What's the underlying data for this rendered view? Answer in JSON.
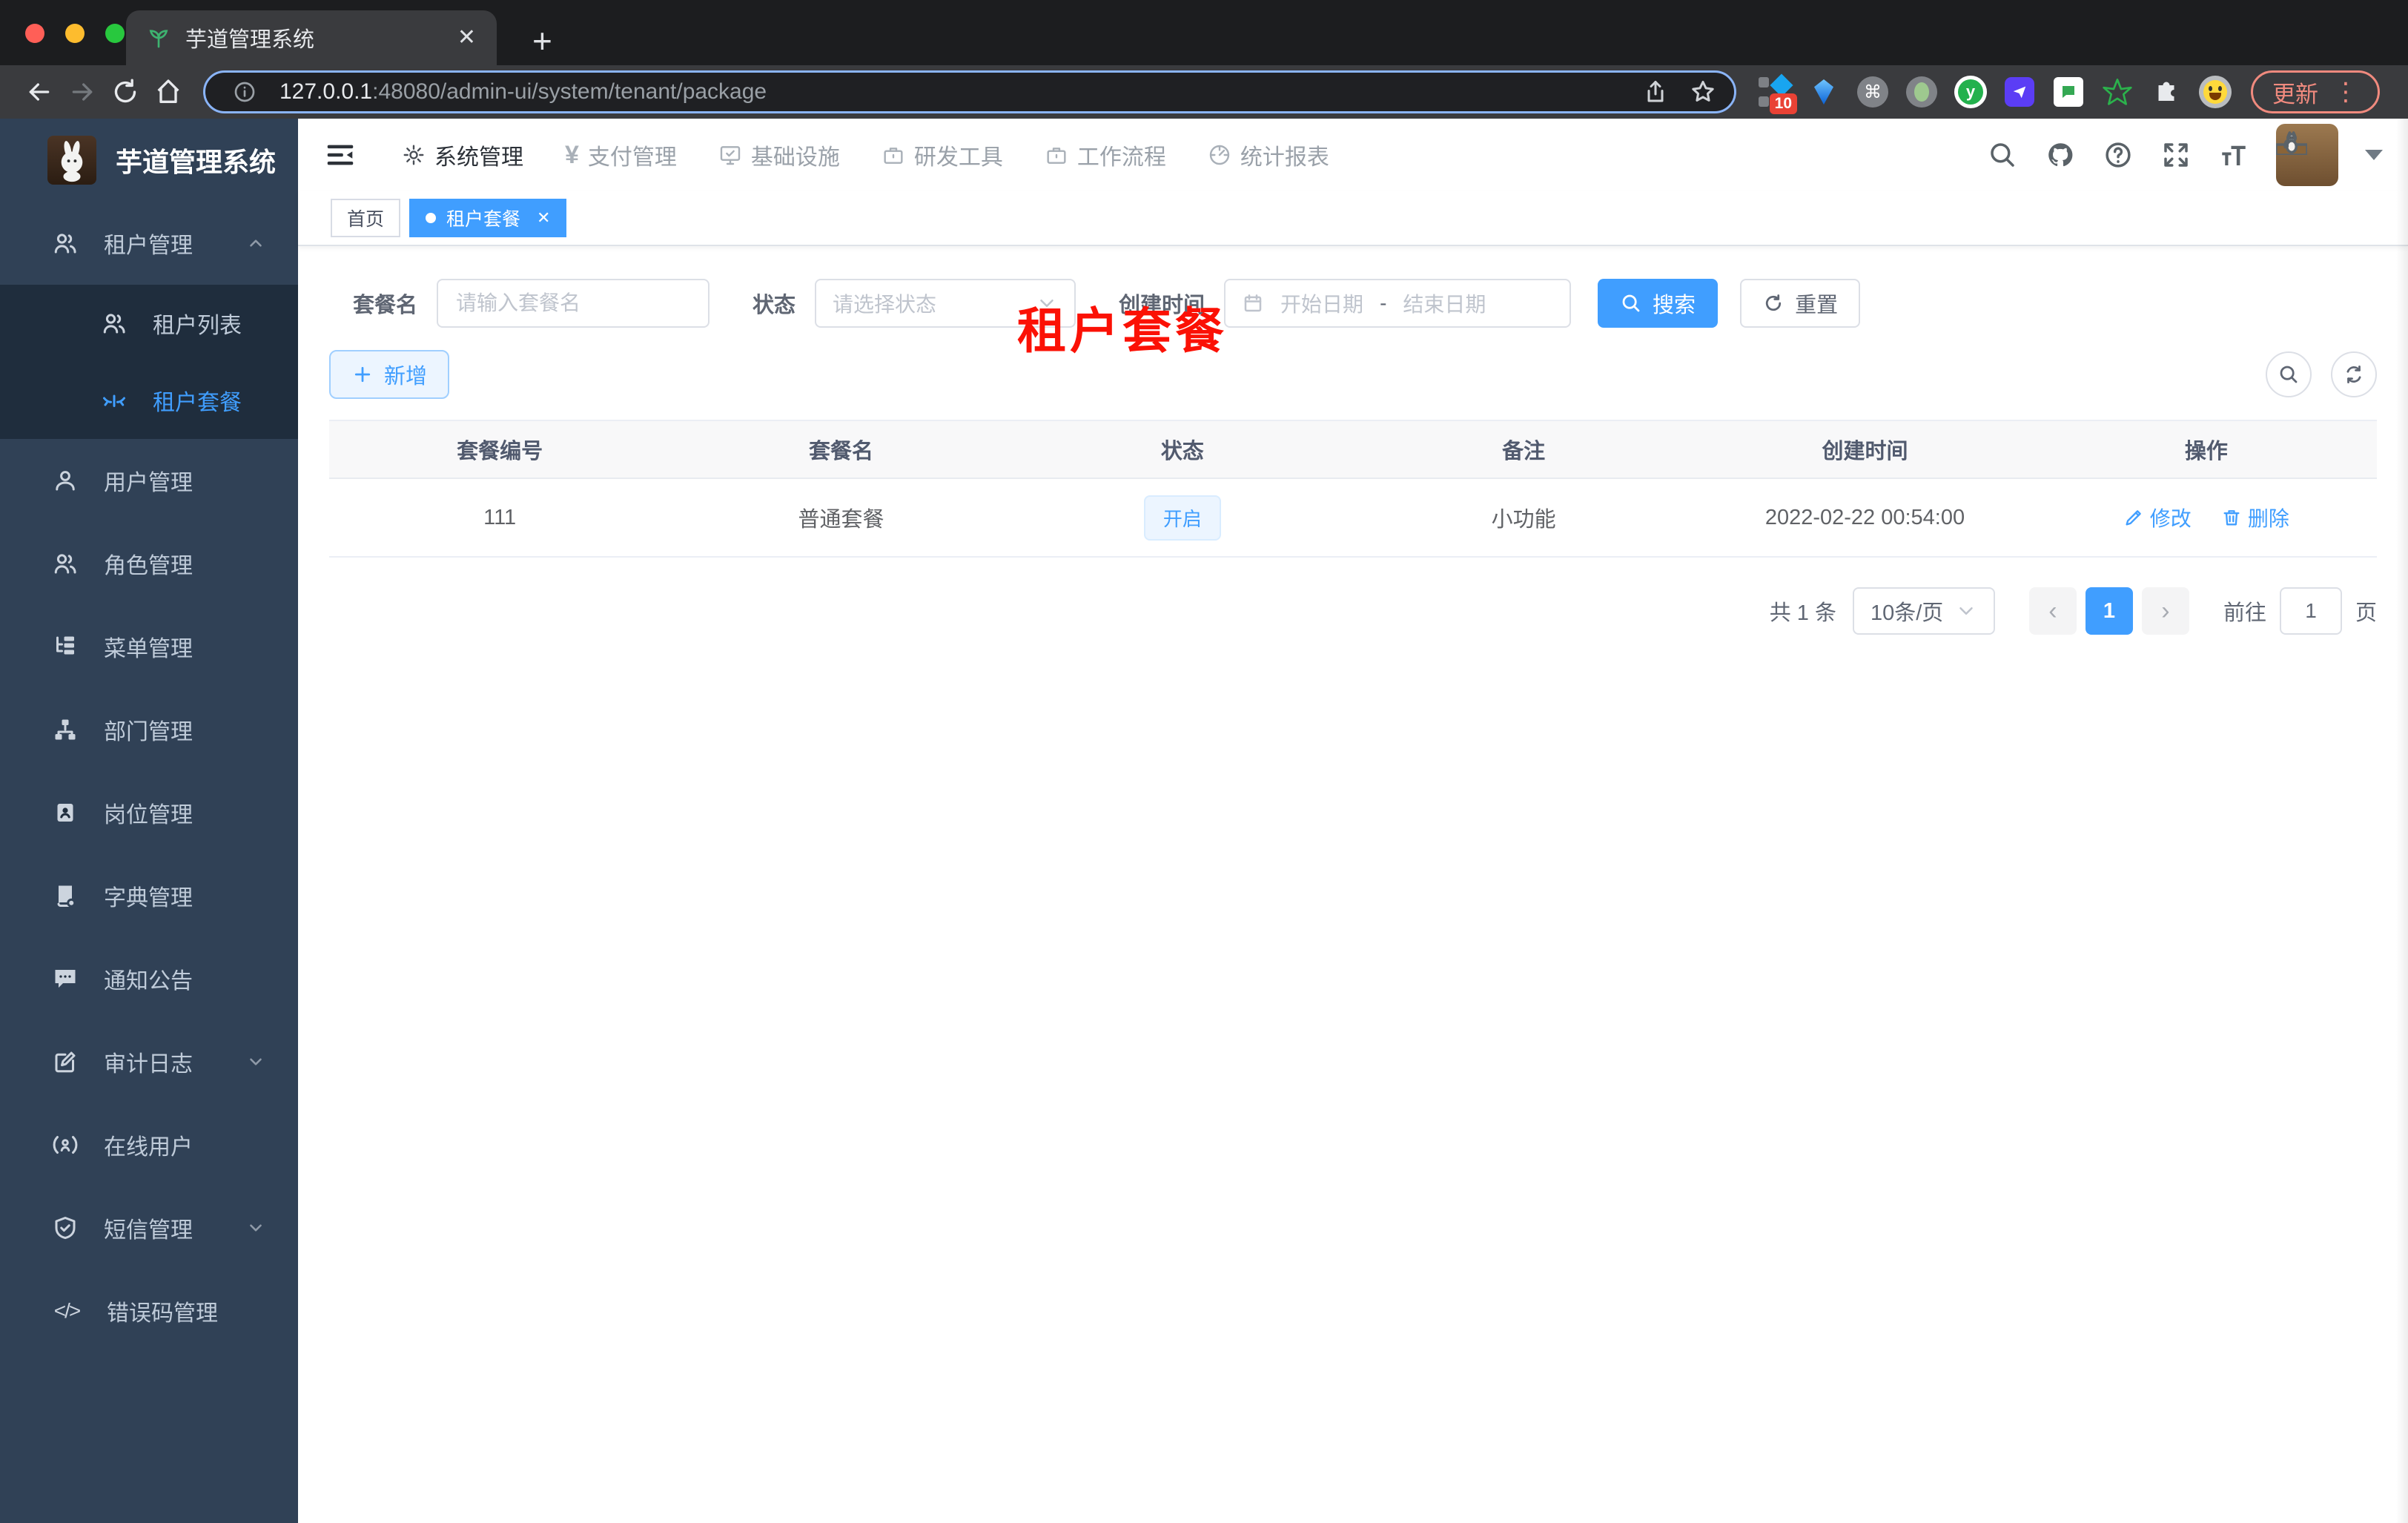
{
  "browser": {
    "tab_title": "芋道管理系统",
    "url": {
      "host": "127.0.0.1",
      "path": ":48080/admin-ui/system/tenant/package"
    },
    "extensions_badge": "10",
    "update_label": "更新"
  },
  "glyphs": {
    "close_x": "✕",
    "plus": "+",
    "kebab": "⋮",
    "command": "⌘",
    "yen": "¥",
    "code": "</>",
    "y_letter": "y",
    "prev": "‹",
    "next": "›"
  },
  "sidebar": {
    "logo_title": "芋道管理系统",
    "items": [
      {
        "label": "租户管理"
      },
      {
        "label": "租户列表"
      },
      {
        "label": "租户套餐"
      },
      {
        "label": "用户管理"
      },
      {
        "label": "角色管理"
      },
      {
        "label": "菜单管理"
      },
      {
        "label": "部门管理"
      },
      {
        "label": "岗位管理"
      },
      {
        "label": "字典管理"
      },
      {
        "label": "通知公告"
      },
      {
        "label": "审计日志"
      },
      {
        "label": "在线用户"
      },
      {
        "label": "短信管理"
      },
      {
        "label": "错误码管理"
      }
    ]
  },
  "topnav": {
    "items": [
      {
        "label": "系统管理"
      },
      {
        "label": "支付管理"
      },
      {
        "label": "基础设施"
      },
      {
        "label": "研发工具"
      },
      {
        "label": "工作流程"
      },
      {
        "label": "统计报表"
      }
    ]
  },
  "tags": {
    "home": "首页",
    "active": "租户套餐"
  },
  "overlay_title": "租户套餐",
  "filters": {
    "name_label": "套餐名",
    "name_placeholder": "请输入套餐名",
    "status_label": "状态",
    "status_placeholder": "请选择状态",
    "created_label": "创建时间",
    "date_start": "开始日期",
    "date_sep": "-",
    "date_end": "结束日期",
    "search": "搜索",
    "reset": "重置"
  },
  "toolbar": {
    "add": "新增"
  },
  "table": {
    "columns": [
      "套餐编号",
      "套餐名",
      "状态",
      "备注",
      "创建时间",
      "操作"
    ],
    "row": {
      "id": "111",
      "name": "普通套餐",
      "status": "开启",
      "remark": "小功能",
      "created": "2022-02-22 00:54:00",
      "edit": "修改",
      "delete": "删除"
    }
  },
  "pagination": {
    "total": "共 1 条",
    "page_size": "10条/页",
    "current": "1",
    "goto_prefix": "前往",
    "goto_value": "1",
    "goto_suffix": "页"
  },
  "colors": {
    "accent": "#409eff",
    "sidebar_bg": "#304156",
    "submenu_bg": "#1f2d3d",
    "tag_active": "#409eff",
    "overlay_red": "#fb1105",
    "update_pink": "#f08a7e"
  }
}
